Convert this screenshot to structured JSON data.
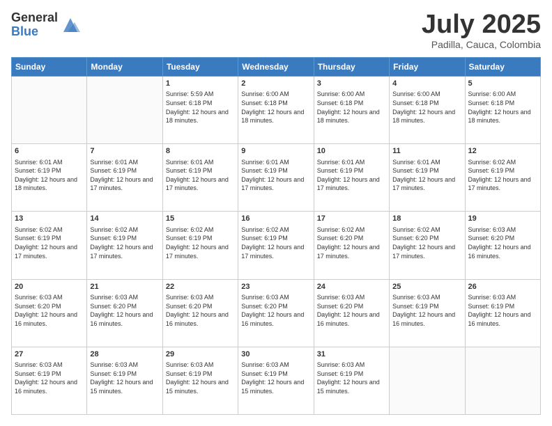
{
  "header": {
    "logo_general": "General",
    "logo_blue": "Blue",
    "month_title": "July 2025",
    "subtitle": "Padilla, Cauca, Colombia"
  },
  "days_of_week": [
    "Sunday",
    "Monday",
    "Tuesday",
    "Wednesday",
    "Thursday",
    "Friday",
    "Saturday"
  ],
  "weeks": [
    [
      {
        "date": "",
        "sunrise": "",
        "sunset": "",
        "daylight": "",
        "empty": true
      },
      {
        "date": "",
        "sunrise": "",
        "sunset": "",
        "daylight": "",
        "empty": true
      },
      {
        "date": "1",
        "sunrise": "Sunrise: 5:59 AM",
        "sunset": "Sunset: 6:18 PM",
        "daylight": "Daylight: 12 hours and 18 minutes.",
        "empty": false
      },
      {
        "date": "2",
        "sunrise": "Sunrise: 6:00 AM",
        "sunset": "Sunset: 6:18 PM",
        "daylight": "Daylight: 12 hours and 18 minutes.",
        "empty": false
      },
      {
        "date": "3",
        "sunrise": "Sunrise: 6:00 AM",
        "sunset": "Sunset: 6:18 PM",
        "daylight": "Daylight: 12 hours and 18 minutes.",
        "empty": false
      },
      {
        "date": "4",
        "sunrise": "Sunrise: 6:00 AM",
        "sunset": "Sunset: 6:18 PM",
        "daylight": "Daylight: 12 hours and 18 minutes.",
        "empty": false
      },
      {
        "date": "5",
        "sunrise": "Sunrise: 6:00 AM",
        "sunset": "Sunset: 6:18 PM",
        "daylight": "Daylight: 12 hours and 18 minutes.",
        "empty": false
      }
    ],
    [
      {
        "date": "6",
        "sunrise": "Sunrise: 6:01 AM",
        "sunset": "Sunset: 6:19 PM",
        "daylight": "Daylight: 12 hours and 18 minutes.",
        "empty": false
      },
      {
        "date": "7",
        "sunrise": "Sunrise: 6:01 AM",
        "sunset": "Sunset: 6:19 PM",
        "daylight": "Daylight: 12 hours and 17 minutes.",
        "empty": false
      },
      {
        "date": "8",
        "sunrise": "Sunrise: 6:01 AM",
        "sunset": "Sunset: 6:19 PM",
        "daylight": "Daylight: 12 hours and 17 minutes.",
        "empty": false
      },
      {
        "date": "9",
        "sunrise": "Sunrise: 6:01 AM",
        "sunset": "Sunset: 6:19 PM",
        "daylight": "Daylight: 12 hours and 17 minutes.",
        "empty": false
      },
      {
        "date": "10",
        "sunrise": "Sunrise: 6:01 AM",
        "sunset": "Sunset: 6:19 PM",
        "daylight": "Daylight: 12 hours and 17 minutes.",
        "empty": false
      },
      {
        "date": "11",
        "sunrise": "Sunrise: 6:01 AM",
        "sunset": "Sunset: 6:19 PM",
        "daylight": "Daylight: 12 hours and 17 minutes.",
        "empty": false
      },
      {
        "date": "12",
        "sunrise": "Sunrise: 6:02 AM",
        "sunset": "Sunset: 6:19 PM",
        "daylight": "Daylight: 12 hours and 17 minutes.",
        "empty": false
      }
    ],
    [
      {
        "date": "13",
        "sunrise": "Sunrise: 6:02 AM",
        "sunset": "Sunset: 6:19 PM",
        "daylight": "Daylight: 12 hours and 17 minutes.",
        "empty": false
      },
      {
        "date": "14",
        "sunrise": "Sunrise: 6:02 AM",
        "sunset": "Sunset: 6:19 PM",
        "daylight": "Daylight: 12 hours and 17 minutes.",
        "empty": false
      },
      {
        "date": "15",
        "sunrise": "Sunrise: 6:02 AM",
        "sunset": "Sunset: 6:19 PM",
        "daylight": "Daylight: 12 hours and 17 minutes.",
        "empty": false
      },
      {
        "date": "16",
        "sunrise": "Sunrise: 6:02 AM",
        "sunset": "Sunset: 6:19 PM",
        "daylight": "Daylight: 12 hours and 17 minutes.",
        "empty": false
      },
      {
        "date": "17",
        "sunrise": "Sunrise: 6:02 AM",
        "sunset": "Sunset: 6:20 PM",
        "daylight": "Daylight: 12 hours and 17 minutes.",
        "empty": false
      },
      {
        "date": "18",
        "sunrise": "Sunrise: 6:02 AM",
        "sunset": "Sunset: 6:20 PM",
        "daylight": "Daylight: 12 hours and 17 minutes.",
        "empty": false
      },
      {
        "date": "19",
        "sunrise": "Sunrise: 6:03 AM",
        "sunset": "Sunset: 6:20 PM",
        "daylight": "Daylight: 12 hours and 16 minutes.",
        "empty": false
      }
    ],
    [
      {
        "date": "20",
        "sunrise": "Sunrise: 6:03 AM",
        "sunset": "Sunset: 6:20 PM",
        "daylight": "Daylight: 12 hours and 16 minutes.",
        "empty": false
      },
      {
        "date": "21",
        "sunrise": "Sunrise: 6:03 AM",
        "sunset": "Sunset: 6:20 PM",
        "daylight": "Daylight: 12 hours and 16 minutes.",
        "empty": false
      },
      {
        "date": "22",
        "sunrise": "Sunrise: 6:03 AM",
        "sunset": "Sunset: 6:20 PM",
        "daylight": "Daylight: 12 hours and 16 minutes.",
        "empty": false
      },
      {
        "date": "23",
        "sunrise": "Sunrise: 6:03 AM",
        "sunset": "Sunset: 6:20 PM",
        "daylight": "Daylight: 12 hours and 16 minutes.",
        "empty": false
      },
      {
        "date": "24",
        "sunrise": "Sunrise: 6:03 AM",
        "sunset": "Sunset: 6:20 PM",
        "daylight": "Daylight: 12 hours and 16 minutes.",
        "empty": false
      },
      {
        "date": "25",
        "sunrise": "Sunrise: 6:03 AM",
        "sunset": "Sunset: 6:19 PM",
        "daylight": "Daylight: 12 hours and 16 minutes.",
        "empty": false
      },
      {
        "date": "26",
        "sunrise": "Sunrise: 6:03 AM",
        "sunset": "Sunset: 6:19 PM",
        "daylight": "Daylight: 12 hours and 16 minutes.",
        "empty": false
      }
    ],
    [
      {
        "date": "27",
        "sunrise": "Sunrise: 6:03 AM",
        "sunset": "Sunset: 6:19 PM",
        "daylight": "Daylight: 12 hours and 16 minutes.",
        "empty": false
      },
      {
        "date": "28",
        "sunrise": "Sunrise: 6:03 AM",
        "sunset": "Sunset: 6:19 PM",
        "daylight": "Daylight: 12 hours and 15 minutes.",
        "empty": false
      },
      {
        "date": "29",
        "sunrise": "Sunrise: 6:03 AM",
        "sunset": "Sunset: 6:19 PM",
        "daylight": "Daylight: 12 hours and 15 minutes.",
        "empty": false
      },
      {
        "date": "30",
        "sunrise": "Sunrise: 6:03 AM",
        "sunset": "Sunset: 6:19 PM",
        "daylight": "Daylight: 12 hours and 15 minutes.",
        "empty": false
      },
      {
        "date": "31",
        "sunrise": "Sunrise: 6:03 AM",
        "sunset": "Sunset: 6:19 PM",
        "daylight": "Daylight: 12 hours and 15 minutes.",
        "empty": false
      },
      {
        "date": "",
        "sunrise": "",
        "sunset": "",
        "daylight": "",
        "empty": true
      },
      {
        "date": "",
        "sunrise": "",
        "sunset": "",
        "daylight": "",
        "empty": true
      }
    ]
  ]
}
